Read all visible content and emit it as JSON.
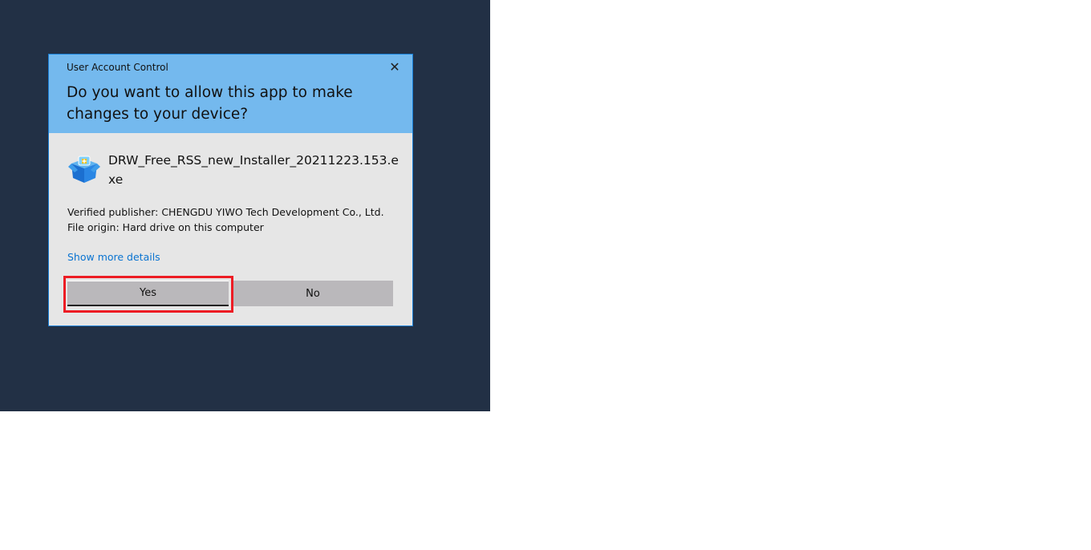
{
  "dialog": {
    "title": "User Account Control",
    "question": "Do you want to allow this app to make changes to your device?",
    "app_name": "DRW_Free_RSS_new_Installer_20211223.153.exe",
    "publisher": "Verified publisher: CHENGDU YIWO Tech Development Co., Ltd.",
    "origin": "File origin: Hard drive on this computer",
    "details_link": "Show more details",
    "yes_label": "Yes",
    "no_label": "No"
  },
  "colors": {
    "header": "#74b9ee",
    "highlight": "#ed1c24",
    "link": "#0a74d1"
  }
}
